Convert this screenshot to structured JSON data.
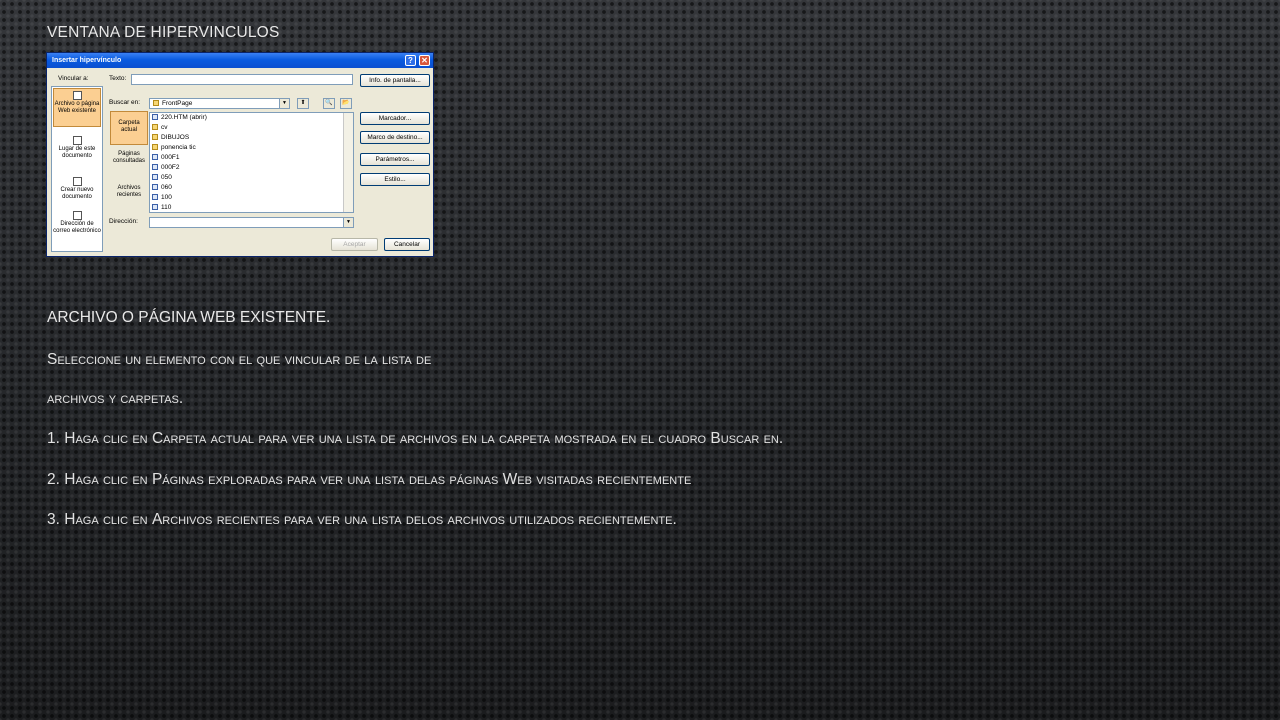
{
  "slide": {
    "title": "Ventana de hipervinculos",
    "heading": "Archivo o página Web existente.",
    "line1_first": "S",
    "line1_rest": "eleccione un elemento con el que vincular de la lista de",
    "line2": "archivos y carpetas.",
    "item1_num": "1. H",
    "item1_a": "aga clic en ",
    "item1_cap1": "C",
    "item1_b": "arpeta actual para ver una lista de archivos en la carpeta mostrada en el cuadro ",
    "item1_cap2": "B",
    "item1_c": "uscar en.",
    "item2_num": "2. H",
    "item2_a": "aga clic en ",
    "item2_cap1": "P",
    "item2_b": "áginas exploradas para ver una lista delas páginas ",
    "item2_cap2": "W",
    "item2_c": "eb visitadas recientemente",
    "item3_num": "3. H",
    "item3_a": "aga clic en ",
    "item3_cap1": "A",
    "item3_b": "rchivos recientes para ver una lista delos archivos utilizados recientemente."
  },
  "dialog": {
    "title": "Insertar hipervínculo",
    "help_glyph": "?",
    "close_glyph": "✕",
    "link_to_label": "Vincular a:",
    "text_label": "Texto:",
    "text_value": "",
    "screen_tip_button": "Info. de pantalla...",
    "look_in_label": "Buscar en:",
    "look_in_value": "FrontPage",
    "sidebar": [
      "Archivo o página Web existente",
      "Lugar de este documento",
      "Crear nuevo documento",
      "Dirección de correo electrónico"
    ],
    "inner_nav": [
      "Carpeta actual",
      "Páginas consultadas",
      "Archivos recientes"
    ],
    "files": [
      {
        "name": "220.HTM (abrir)",
        "icon": "page-icon"
      },
      {
        "name": "cv",
        "icon": "folder-icon"
      },
      {
        "name": "DIBUJOS",
        "icon": "folder-icon"
      },
      {
        "name": "ponencia tic",
        "icon": "folder-icon"
      },
      {
        "name": "000F1",
        "icon": "page-icon"
      },
      {
        "name": "000F2",
        "icon": "page-icon"
      },
      {
        "name": "050",
        "icon": "page-icon"
      },
      {
        "name": "060",
        "icon": "page-icon"
      },
      {
        "name": "100",
        "icon": "page-icon"
      },
      {
        "name": "110",
        "icon": "page-icon"
      }
    ],
    "bookmark_button": "Marcador...",
    "target_frame_button": "Marco de destino...",
    "parameters_button": "Parámetros...",
    "style_button": "Estilo...",
    "address_label": "Dirección:",
    "address_value": "",
    "ok_button": "Aceptar",
    "cancel_button": "Cancelar"
  }
}
